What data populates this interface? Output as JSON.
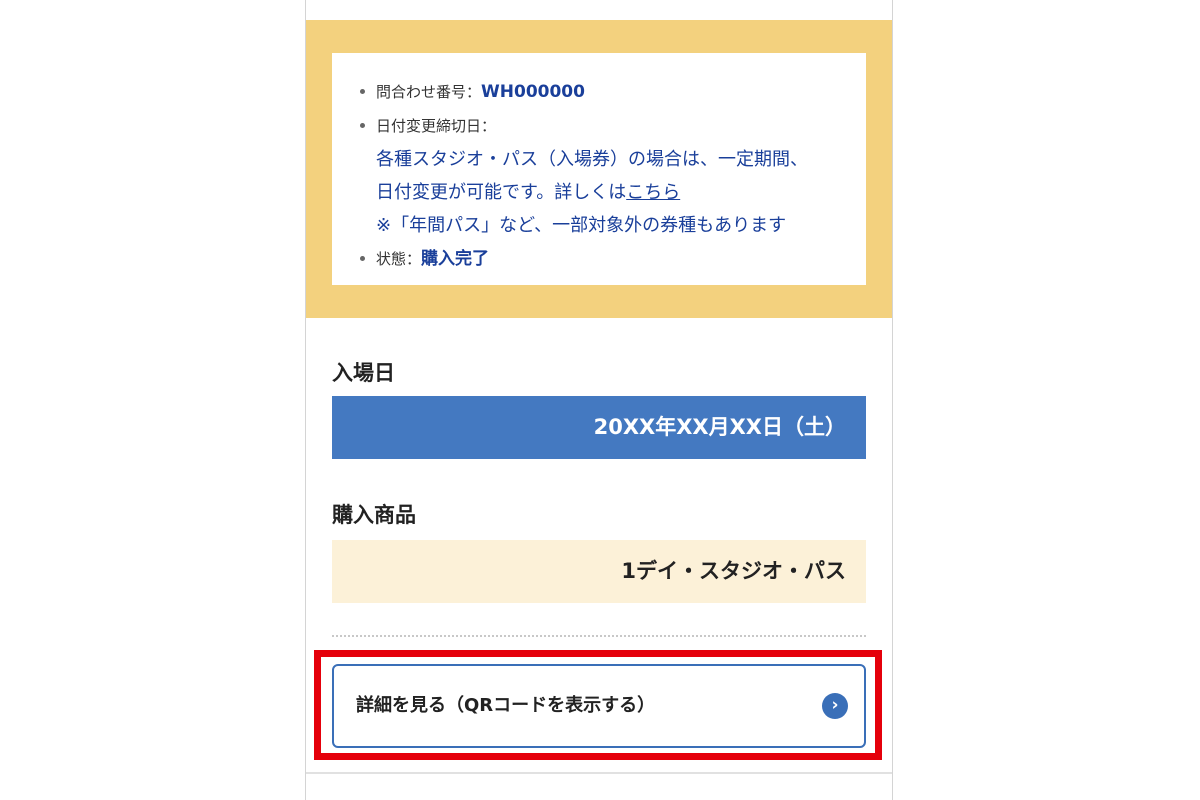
{
  "info": {
    "inquiry_label": "問合わせ番号：",
    "inquiry_value": "WH000000",
    "deadline_label": "日付変更締切日：",
    "note_line1": "各種スタジオ・パス（入場券）の場合は、一定期間、",
    "note_line2_prefix": "日付変更が可能です。詳しくは",
    "note_link": "こちら",
    "note_line3": "※「年間パス」など、一部対象外の券種もあります",
    "status_label": "状態：",
    "status_value": "購入完了"
  },
  "entry": {
    "heading": "入場日",
    "date": "20XX年XX月XX日（土）"
  },
  "product": {
    "heading": "購入商品",
    "name": "1デイ・スタジオ・パス"
  },
  "detail_button": {
    "label": "詳細を見る（QRコードを表示する）",
    "icon": "chevron-right-icon"
  },
  "colors": {
    "info_border": "#f3d17e",
    "date_bar": "#4479c1",
    "product_bar": "#fcf1d8",
    "link_blue": "#1a3f9a",
    "highlight": "#e5000b"
  }
}
